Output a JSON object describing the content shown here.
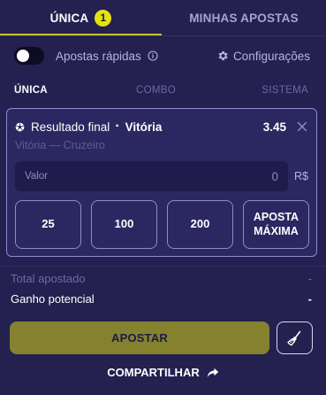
{
  "tabs": {
    "single_label": "ÚNICA",
    "single_count": "1",
    "my_bets_label": "MINHAS APOSTAS"
  },
  "quick_bets": {
    "label": "Apostas rápidas",
    "enabled": false
  },
  "settings": {
    "label": "Configurações"
  },
  "bet_modes": {
    "single": "ÚNICA",
    "combo": "COMBO",
    "system": "SISTEMA"
  },
  "selection": {
    "market": "Resultado final",
    "separator": "·",
    "pick": "Vitória",
    "odds": "3.45",
    "match": "Vitória — Cruzeiro"
  },
  "stake": {
    "placeholder": "Valor",
    "value": "0",
    "currency": "R$"
  },
  "quick_amounts": [
    "25",
    "100",
    "200"
  ],
  "max_bet_label": "APOSTA MÁXIMA",
  "summary": {
    "total_label": "Total apostado",
    "total_value": "-",
    "potential_label": "Ganho potencial",
    "potential_value": "-"
  },
  "actions": {
    "bet_label": "APOSTAR",
    "share_label": "COMPARTILHAR"
  },
  "icons": [
    "info-icon",
    "gear-icon",
    "soccer-ball-icon",
    "close-icon",
    "broom-icon",
    "share-arrow-icon"
  ],
  "colors": {
    "accent": "#e6e20f",
    "background": "#24204f",
    "bet_button": "#84822f"
  }
}
